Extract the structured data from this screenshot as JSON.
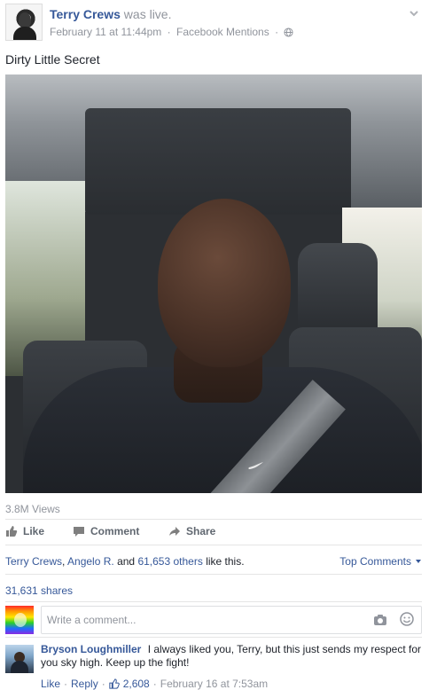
{
  "post": {
    "author": "Terry Crews",
    "action": "was live.",
    "timestamp": "February 11 at 11:44pm",
    "source": "Facebook Mentions",
    "text": "Dirty Little Secret",
    "icons": {
      "menu": "chevron-down-icon",
      "privacy": "globe-icon"
    }
  },
  "video": {
    "views": "3.8M Views"
  },
  "actions": {
    "like": "Like",
    "comment": "Comment",
    "share": "Share"
  },
  "engagement": {
    "liker1": "Terry Crews",
    "comma": ",",
    "liker2": "Angelo R.",
    "and_text": "and",
    "others": "61,653 others",
    "suffix": "like this.",
    "top_comments": "Top Comments",
    "shares": "31,631 shares"
  },
  "composer": {
    "placeholder": "Write a comment..."
  },
  "comment": {
    "author": "Bryson Loughmiller",
    "text": "I always liked you, Terry, but this just sends my respect for you sky high. Keep up the fight!",
    "like": "Like",
    "reply": "Reply",
    "reactions": "2,608",
    "time": "February 16 at 7:53am",
    "dot": "·"
  },
  "colors": {
    "link": "#365899",
    "muted": "#90949c",
    "text": "#1d2129",
    "divider": "#e5e5e5"
  }
}
